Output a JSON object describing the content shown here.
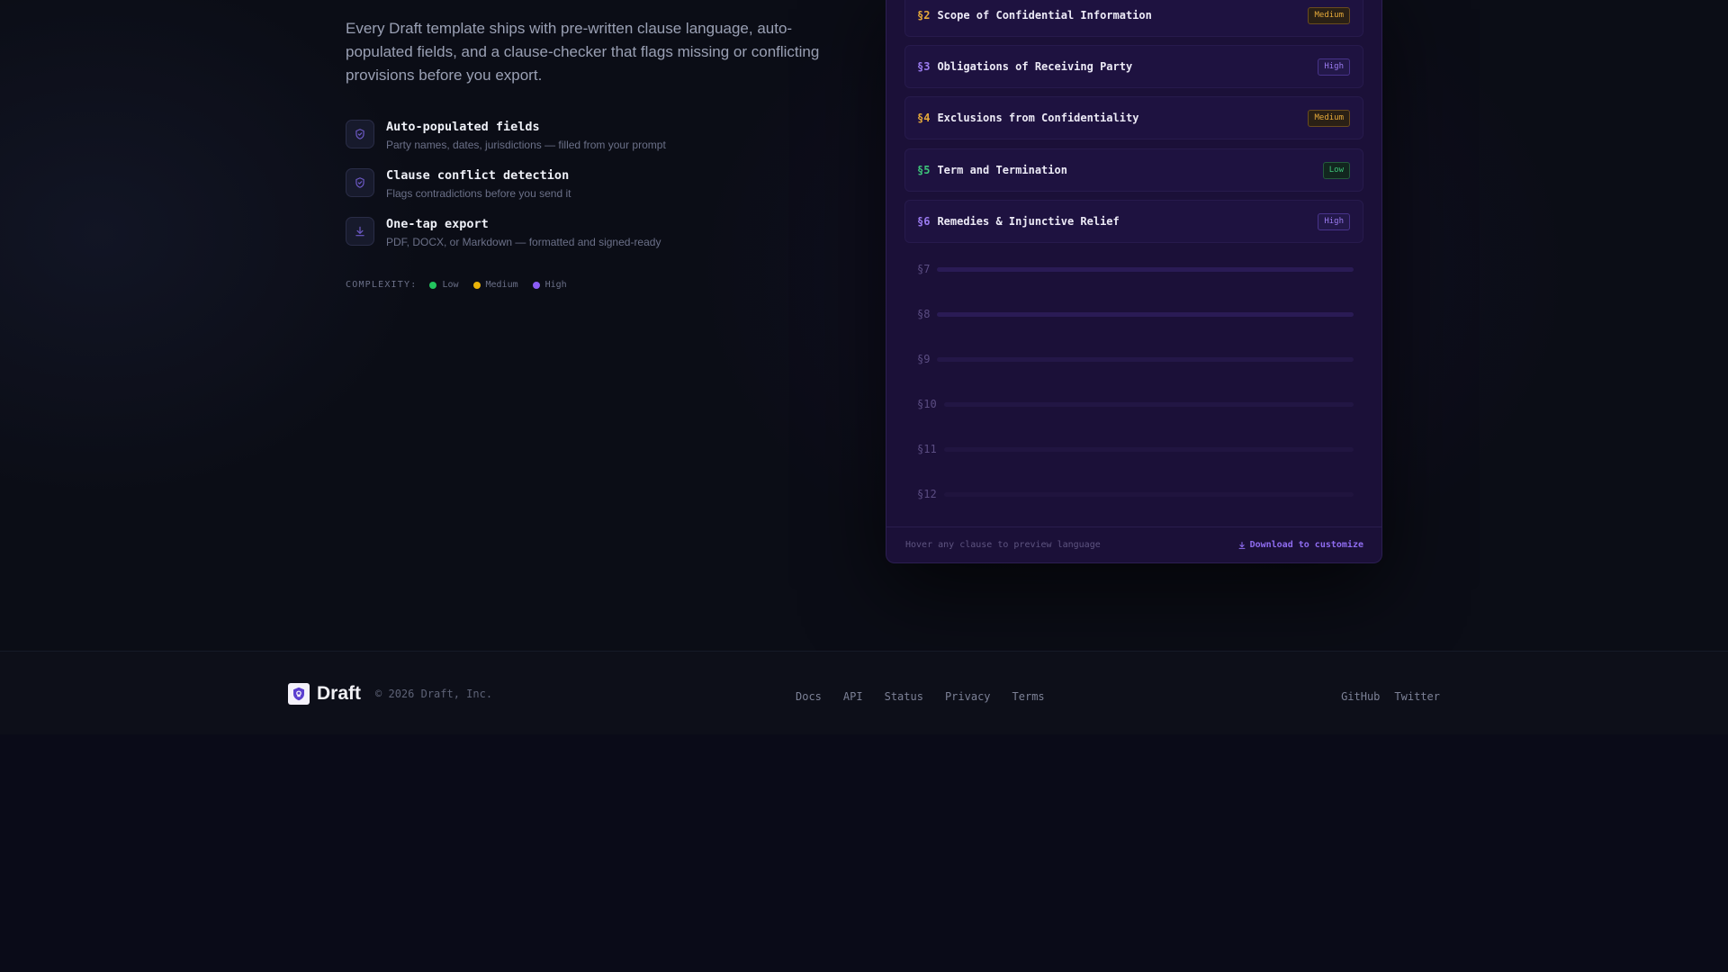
{
  "intro": "Every Draft template ships with pre-written clause language, auto-populated fields, and a clause-checker that flags missing or conflicting provisions before you export.",
  "features": [
    {
      "icon": "shield-check-icon",
      "title": "Auto-populated fields",
      "desc": "Party names, dates, jurisdictions — filled from your prompt"
    },
    {
      "icon": "shield-check-icon",
      "title": "Clause conflict detection",
      "desc": "Flags contradictions before you send it"
    },
    {
      "icon": "download-icon",
      "title": "One-tap export",
      "desc": "PDF, DOCX, or Markdown — formatted and signed-ready"
    }
  ],
  "legend": {
    "label": "COMPLEXITY:",
    "items": [
      {
        "label": "Low",
        "color": "#22c55e"
      },
      {
        "label": "Medium",
        "color": "#eab308"
      },
      {
        "label": "High",
        "color": "#8b5cf6"
      }
    ]
  },
  "colors": {
    "low": "#3ec57a",
    "medium": "#e5a93a",
    "high": "#9b7bf0",
    "accent": "#8f6cf0"
  },
  "clauses": [
    {
      "num": "§2",
      "name": "Scope of Confidential Information",
      "level": "Medium"
    },
    {
      "num": "§3",
      "name": "Obligations of Receiving Party",
      "level": "High"
    },
    {
      "num": "§4",
      "name": "Exclusions from Confidentiality",
      "level": "Medium"
    },
    {
      "num": "§5",
      "name": "Term and Termination",
      "level": "Low"
    },
    {
      "num": "§6",
      "name": "Remedies & Injunctive Relief",
      "level": "High"
    }
  ],
  "pending_clauses": [
    "§7",
    "§8",
    "§9",
    "§10",
    "§11",
    "§12"
  ],
  "card_footer": {
    "hint": "Hover any clause to preview language",
    "download": "Download to customize"
  },
  "footer": {
    "brand": "Draft",
    "copyright": "© 2026 Draft, Inc.",
    "links": [
      "Docs",
      "API",
      "Status",
      "Privacy",
      "Terms"
    ],
    "social": [
      "GitHub",
      "Twitter"
    ]
  }
}
